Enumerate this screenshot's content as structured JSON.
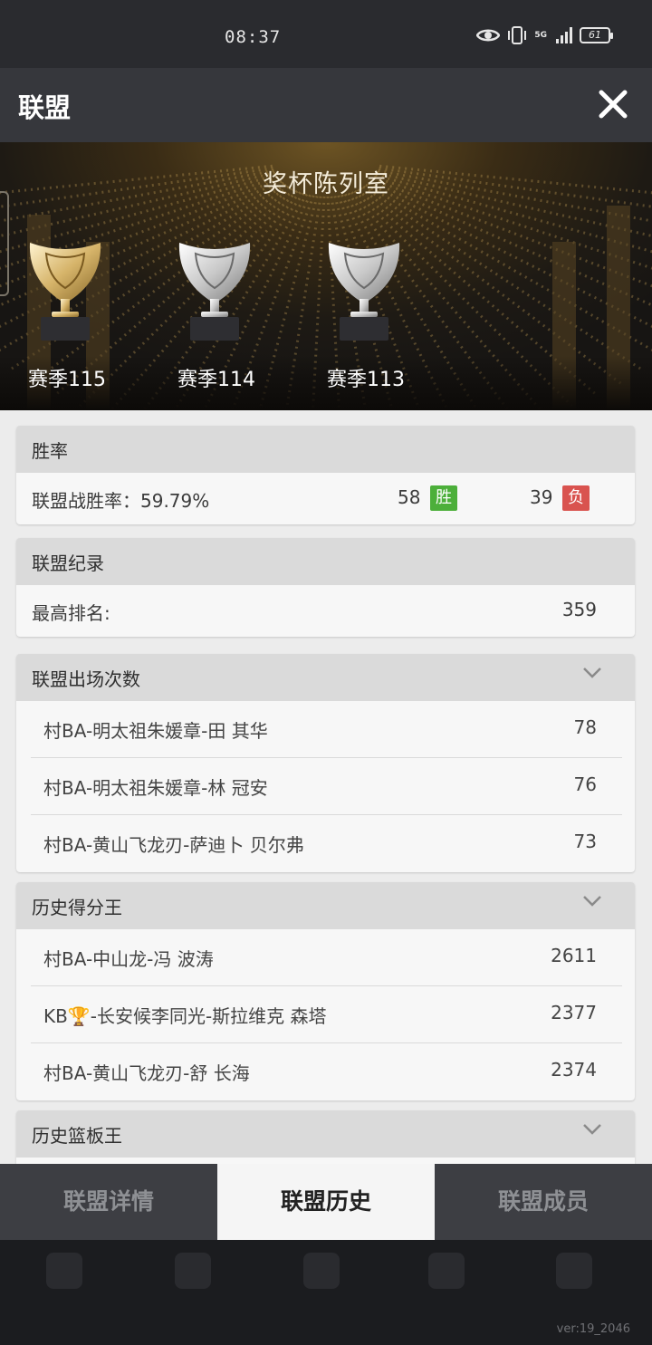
{
  "status_bar": {
    "time": "08:37",
    "battery": "61",
    "network": "5G"
  },
  "header": {
    "title": "联盟"
  },
  "trophy_room": {
    "title": "奖杯陈列室",
    "trophies": [
      {
        "label": "赛季115",
        "tier": "gold"
      },
      {
        "label": "赛季114",
        "tier": "silver"
      },
      {
        "label": "赛季113",
        "tier": "silver"
      }
    ]
  },
  "win_rate": {
    "title": "胜率",
    "label": "联盟战胜率：59.79%",
    "wins": "58",
    "win_badge": "胜",
    "losses": "39",
    "loss_badge": "负",
    "win_color": "#4caf3a",
    "loss_color": "#d9534f"
  },
  "record": {
    "title": "联盟纪录",
    "label": "最高排名:",
    "value": "359"
  },
  "appearances": {
    "title": "联盟出场次数",
    "rows": [
      {
        "name": "村BA-明太祖朱媛章-田 其华",
        "value": "78"
      },
      {
        "name": "村BA-明太祖朱媛章-林 冠安",
        "value": "76"
      },
      {
        "name": "村BA-黄山飞龙刃-萨迪卜 贝尔弗",
        "value": "73"
      }
    ]
  },
  "scoring": {
    "title": "历史得分王",
    "rows": [
      {
        "name": "村BA-中山龙-冯 波涛",
        "value": "2611"
      },
      {
        "name": "KB🏆-长安候李同光-斯拉维克 森塔",
        "value": "2377"
      },
      {
        "name": "村BA-黄山飞龙刃-舒 长海",
        "value": "2374"
      }
    ]
  },
  "rebounds": {
    "title": "历史篮板王"
  },
  "tabs": [
    {
      "label": "联盟详情",
      "active": false
    },
    {
      "label": "联盟历史",
      "active": true
    },
    {
      "label": "联盟成员",
      "active": false
    }
  ],
  "version": "ver:19_2046"
}
